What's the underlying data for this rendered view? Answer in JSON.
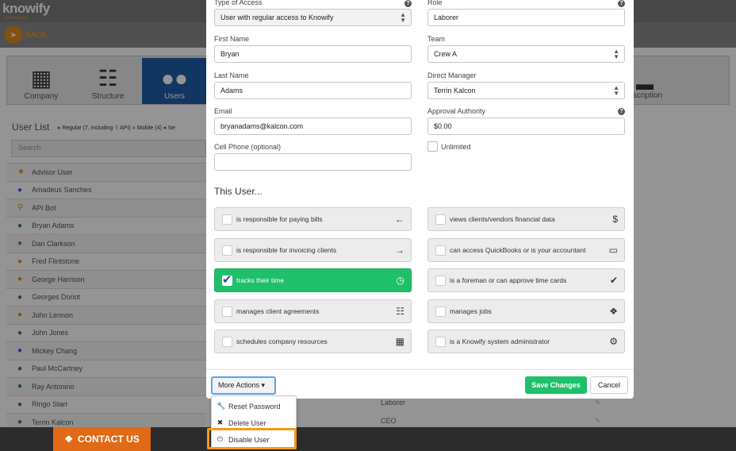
{
  "app": {
    "logo": "knowify",
    "logo_sub": "Contractors",
    "back_label": "BACK"
  },
  "nav_tiles": [
    {
      "label": "Company",
      "icon": "building-icon"
    },
    {
      "label": "Structure",
      "icon": "org-chart-icon"
    },
    {
      "label": "Users",
      "icon": "users-icon",
      "active": true
    },
    {
      "label": "scription",
      "icon": "card-icon"
    }
  ],
  "user_list": {
    "title": "User List",
    "legend": {
      "regular": "Regular (7, including",
      "api": "API)",
      "mobile": "Mobile (4)",
      "other": "Ne"
    },
    "search_placeholder": "Search",
    "users": [
      {
        "name": "Advisor User",
        "icon": "star-icon",
        "color": "#e08a1c"
      },
      {
        "name": "Amadeus Sanches",
        "icon": "user-icon",
        "color": "#3a5fc8"
      },
      {
        "name": "API Bot",
        "icon": "key-icon",
        "color": "#e08a1c"
      },
      {
        "name": "Bryan Adams",
        "icon": "user-icon",
        "color": "#2a8a2a"
      },
      {
        "name": "Dan Clarkson",
        "icon": "user-icon",
        "color": "#777777"
      },
      {
        "name": "Fred Flintstone",
        "icon": "user-icon",
        "color": "#e08a1c"
      },
      {
        "name": "George Harrison",
        "icon": "user-icon",
        "color": "#e08a1c"
      },
      {
        "name": "Georges Doriot",
        "icon": "user-icon",
        "color": "#2a8a2a"
      },
      {
        "name": "John Lennon",
        "icon": "user-icon",
        "color": "#e08a1c"
      },
      {
        "name": "John Jones",
        "icon": "user-icon",
        "color": "#2a8a2a"
      },
      {
        "name": "Mickey Chang",
        "icon": "user-icon",
        "color": "#3a5fc8"
      },
      {
        "name": "Paul McCartney",
        "icon": "user-icon",
        "color": "#2a8a2a"
      },
      {
        "name": "Ray Antonino",
        "icon": "user-icon",
        "color": "#2a8a2a"
      },
      {
        "name": "Ringo Starr",
        "icon": "user-icon",
        "color": "#2a8a2a"
      },
      {
        "name": "Terrin Kalcon",
        "icon": "user-icon",
        "color": "#2a8a2a"
      }
    ],
    "roles_visible": [
      "Laborer",
      "CEO"
    ]
  },
  "form": {
    "type_of_access": {
      "label": "Type of Access",
      "value": "User with regular access to Knowify"
    },
    "role": {
      "label": "Role",
      "value": "Laborer"
    },
    "first_name": {
      "label": "First Name",
      "value": "Bryan"
    },
    "team": {
      "label": "Team",
      "value": "Crew A"
    },
    "last_name": {
      "label": "Last Name",
      "value": "Adams"
    },
    "direct_manager": {
      "label": "Direct Manager",
      "value": "Terrin Kalcon"
    },
    "email": {
      "label": "Email",
      "value": "bryanadams@kalcon.com"
    },
    "approval_authority": {
      "label": "Approval Authority",
      "value": "$0.00"
    },
    "cell_phone": {
      "label": "Cell Phone (optional)",
      "value": ""
    },
    "unlimited": {
      "label": "Unlimited",
      "checked": false
    }
  },
  "this_user": {
    "title": "This User...",
    "left": [
      {
        "label": "is responsible for paying bills",
        "icon": "arrow-left-circle-icon",
        "checked": false
      },
      {
        "label": "is responsible for invoicing clients",
        "icon": "arrow-right-circle-icon",
        "checked": false
      },
      {
        "label": "tracks their time",
        "icon": "clock-icon",
        "checked": true
      },
      {
        "label": "manages client agreements",
        "icon": "document-icon",
        "checked": false
      },
      {
        "label": "schedules company resources",
        "icon": "calendar-icon",
        "checked": false
      }
    ],
    "right": [
      {
        "label": "views clients/vendors financial data",
        "icon": "dollar-icon",
        "checked": false
      },
      {
        "label": "can access QuickBooks or is your accountant",
        "icon": "folder-open-icon",
        "checked": false
      },
      {
        "label": "is a foreman or can approve time cards",
        "icon": "check-circle-icon",
        "checked": false
      },
      {
        "label": "manages jobs",
        "icon": "puzzle-icon",
        "checked": false
      },
      {
        "label": "is a Knowify system administrator",
        "icon": "gear-icon",
        "checked": false
      }
    ]
  },
  "footer": {
    "more_actions": "More Actions",
    "save": "Save Changes",
    "cancel": "Cancel",
    "menu": [
      {
        "label": "Reset Password",
        "icon": "wrench-icon"
      },
      {
        "label": "Delete User",
        "icon": "close-icon"
      },
      {
        "label": "Disable User",
        "icon": "power-icon"
      }
    ]
  },
  "contact": {
    "label": "CONTACT US"
  }
}
